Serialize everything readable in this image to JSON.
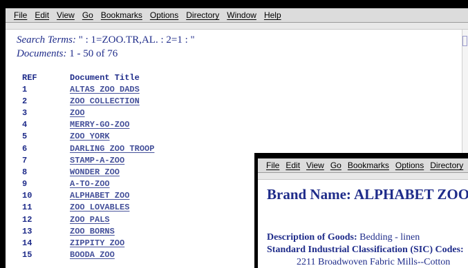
{
  "back_window": {
    "menu": [
      "File",
      "Edit",
      "View",
      "Go",
      "Bookmarks",
      "Options",
      "Directory",
      "Window",
      "Help"
    ],
    "search_label": "Search Terms:",
    "search_value": "\" : 1=ZOO.TR,AL. : 2=1 : \"",
    "documents_label": "Documents:",
    "documents_value": "1 - 50 of 76",
    "columns": {
      "ref": "REF",
      "title": "Document Title"
    },
    "rows": [
      {
        "ref": "1",
        "title": "ALTAS ZOO DADS"
      },
      {
        "ref": "2",
        "title": "ZOO COLLECTION"
      },
      {
        "ref": "3",
        "title": "ZOO"
      },
      {
        "ref": "4",
        "title": "MERRY-GO-ZOO"
      },
      {
        "ref": "5",
        "title": "ZOO YORK"
      },
      {
        "ref": "6",
        "title": "DARLING ZOO TROOP"
      },
      {
        "ref": "7",
        "title": "STAMP-A-ZOO"
      },
      {
        "ref": "8",
        "title": "WONDER ZOO"
      },
      {
        "ref": "9",
        "title": "A-TO-ZOO"
      },
      {
        "ref": "10",
        "title": "ALPHABET ZOO"
      },
      {
        "ref": "11",
        "title": "ZOO LOVABLES"
      },
      {
        "ref": "12",
        "title": "ZOO PALS"
      },
      {
        "ref": "13",
        "title": "ZOO BORNS"
      },
      {
        "ref": "14",
        "title": "ZIPPITY ZOO"
      },
      {
        "ref": "15",
        "title": "BOODA ZOO"
      }
    ]
  },
  "front_window": {
    "menu": [
      "File",
      "Edit",
      "View",
      "Go",
      "Bookmarks",
      "Options",
      "Directory"
    ],
    "brand_heading": "Brand Name: ALPHABET ZOO",
    "desc_label": "Description of Goods:",
    "desc_value": "Bedding - linen",
    "sic_label": "Standard Industrial Classification (SIC) Codes:",
    "sic_item": "2211 Broadwoven Fabric Mills--Cotton"
  },
  "colors": {
    "text_navy": "#1f2c8a",
    "link": "#44509a",
    "menubar": "#dcdcdc"
  }
}
